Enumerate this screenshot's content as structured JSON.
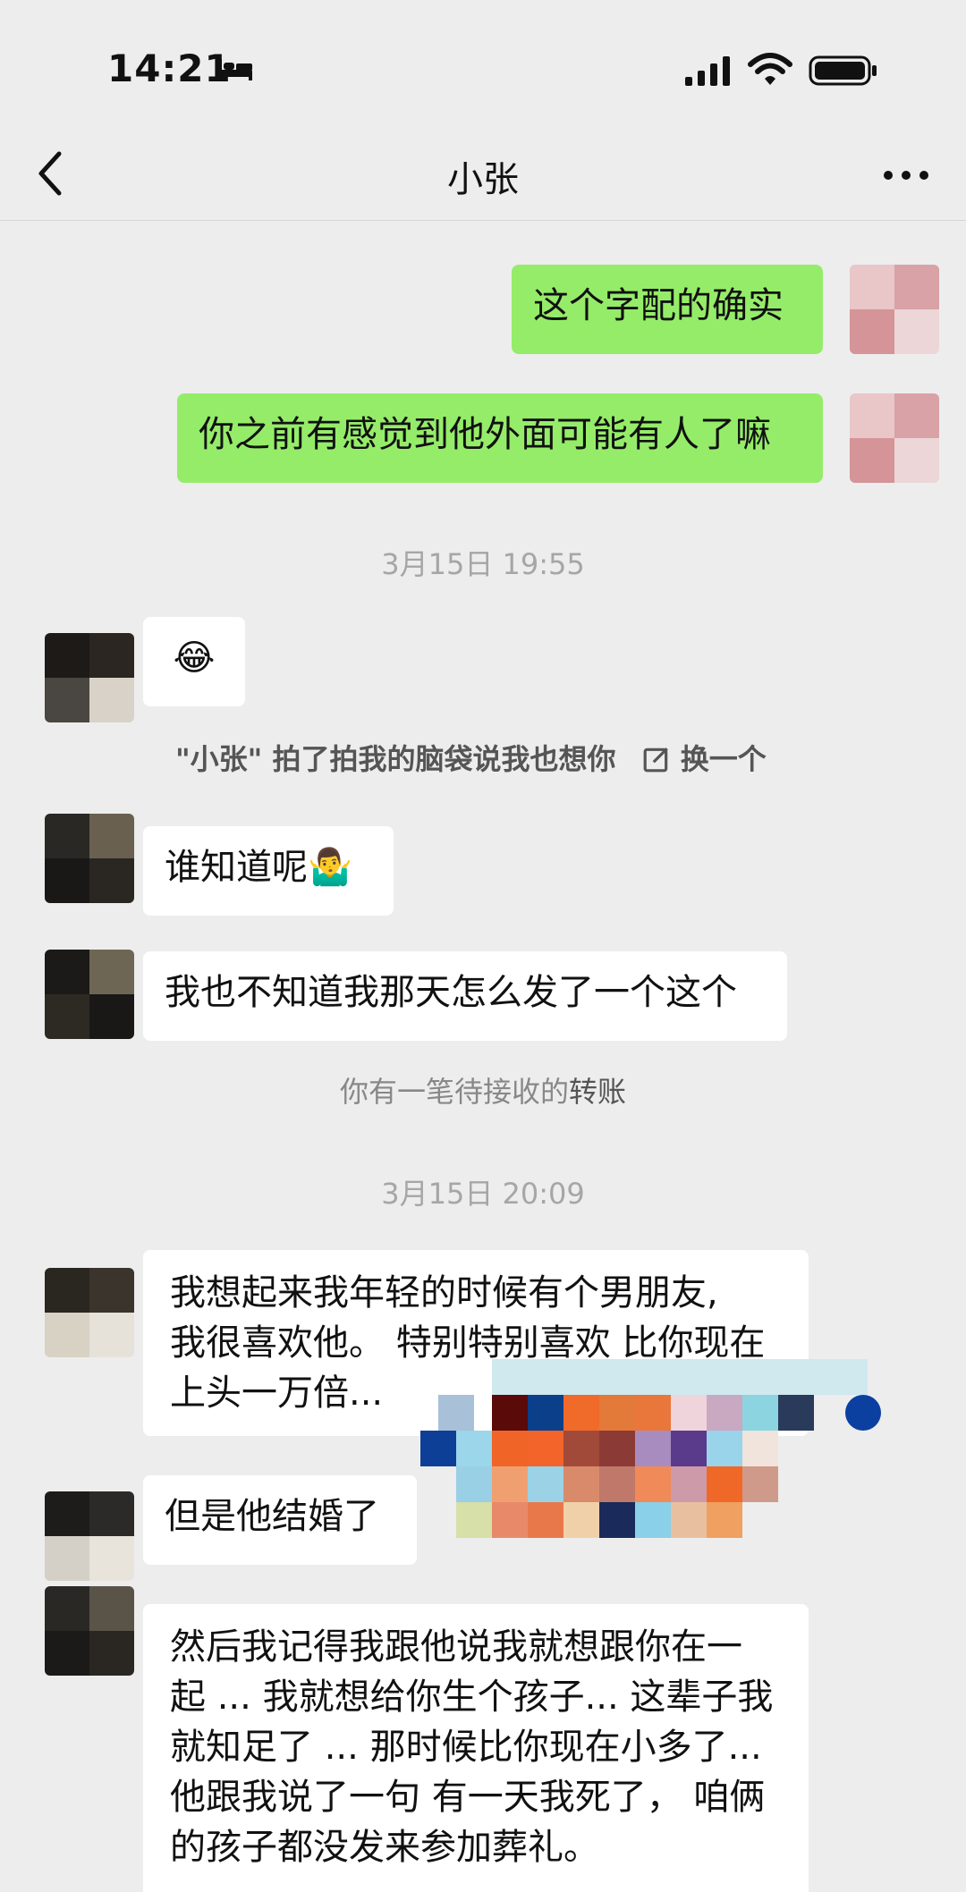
{
  "status_bar": {
    "time": "14:21"
  },
  "nav": {
    "title": "小张"
  },
  "messages": {
    "me_1": "这个字配的确实",
    "me_2": "你之前有感觉到他外面可能有人了嘛",
    "timestamp_1": "3月15日 19:55",
    "emoji_1": "😂",
    "pat_notice": "\"小张\" 拍了拍我的脑袋说我也想你",
    "pat_change": "换一个",
    "them_1": "谁知道呢🤷‍♂️",
    "them_2": "我也不知道我那天怎么发了一个这个",
    "transfer_prefix": "你有一笔待接收的",
    "transfer_link": "转账",
    "timestamp_2": "3月15日 20:09",
    "them_3_line1": "我想起来我年轻的时候有个男朋友,",
    "them_3_line2": "我很喜欢他。 特别特别喜欢 比你现在",
    "them_3_line3": "上头一万倍...",
    "them_4": "但是他结婚了",
    "them_5_line1": "然后我记得我跟他说我就想跟你在一",
    "them_5_line2": "起 ... 我就想给你生个孩子... 这辈子我",
    "them_5_line3": "就知足了 ... 那时候比你现在小多了...",
    "them_5_line4": "他跟我说了一句 有一天我死了， 咱俩",
    "them_5_line5": "的孩子都没发来参加葬礼。"
  },
  "colors": {
    "background": "#ededed",
    "my_bubble": "#95ec69",
    "their_bubble": "#ffffff",
    "timestamp": "#a6a6a6",
    "link": "#576b95"
  },
  "icons": [
    "bed-icon",
    "signal-icon",
    "wifi-icon",
    "battery-icon",
    "back-icon",
    "more-icon",
    "edit-icon"
  ]
}
